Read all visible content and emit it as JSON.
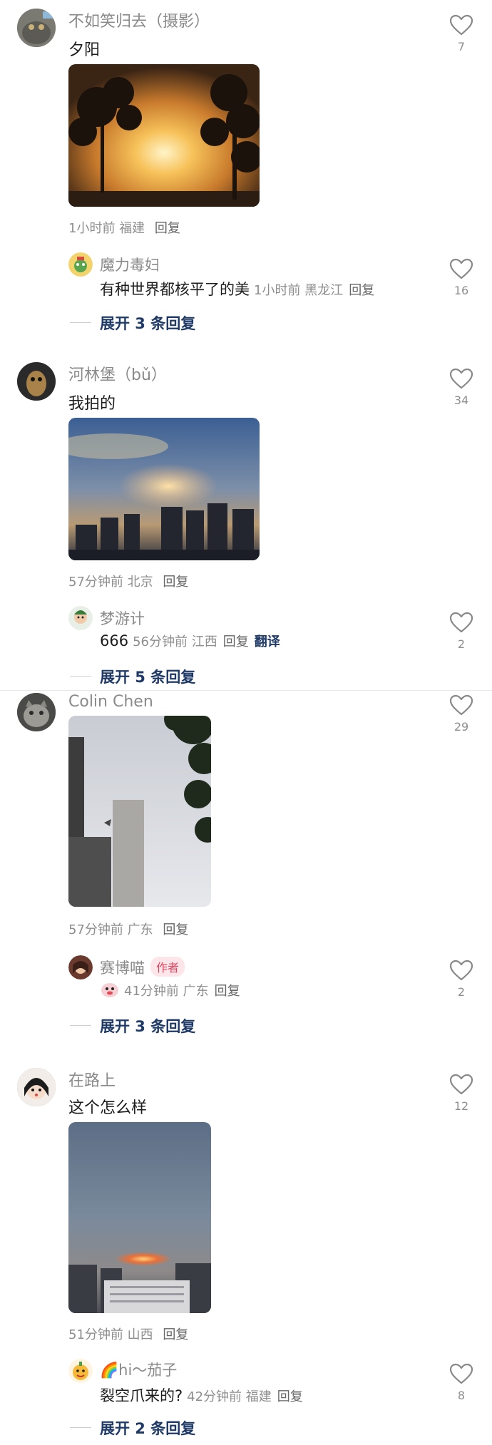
{
  "comments": [
    {
      "username": "不如笑归去（摄影）",
      "text": "夕阳",
      "meta_time": "1小时前",
      "meta_location": "福建",
      "reply_label": "回复",
      "likes": "7",
      "reply": {
        "username": "魔力毒妇",
        "text": "有种世界都核平了的美",
        "time": "1小时前",
        "location": "黑龙江",
        "reply_label": "回复",
        "likes": "16"
      },
      "expand_label": "展开 3 条回复"
    },
    {
      "username": "河林堡（bǔ）",
      "text": "我拍的",
      "meta_time": "57分钟前",
      "meta_location": "北京",
      "reply_label": "回复",
      "likes": "34",
      "reply": {
        "username": "梦游计",
        "text": "666",
        "time": "56分钟前",
        "location": "江西",
        "reply_label": "回复",
        "translate_label": "翻译",
        "likes": "2"
      },
      "expand_label": "展开 5 条回复"
    },
    {
      "username": "Colin Chen",
      "text": "",
      "meta_time": "57分钟前",
      "meta_location": "广东",
      "reply_label": "回复",
      "likes": "29",
      "reply": {
        "username": "赛博喵",
        "badge": "作者",
        "text": "",
        "time": "41分钟前",
        "location": "广东",
        "reply_label": "回复",
        "likes": "2"
      },
      "expand_label": "展开 3 条回复"
    },
    {
      "username": "在路上",
      "text": "这个怎么样",
      "meta_time": "51分钟前",
      "meta_location": "山西",
      "reply_label": "回复",
      "likes": "12",
      "reply": {
        "username": "🌈hi～茄子",
        "text": "裂空爪来的?",
        "time": "42分钟前",
        "location": "福建",
        "reply_label": "回复",
        "likes": "8"
      },
      "expand_label": "展开 2 条回复"
    }
  ],
  "icons": {
    "like": "heart-outline-icon"
  },
  "colors": {
    "expand": "#1f3a66",
    "meta": "#8e8e8e",
    "author_badge_bg": "#fde6ea",
    "author_badge_text": "#e2475f"
  }
}
